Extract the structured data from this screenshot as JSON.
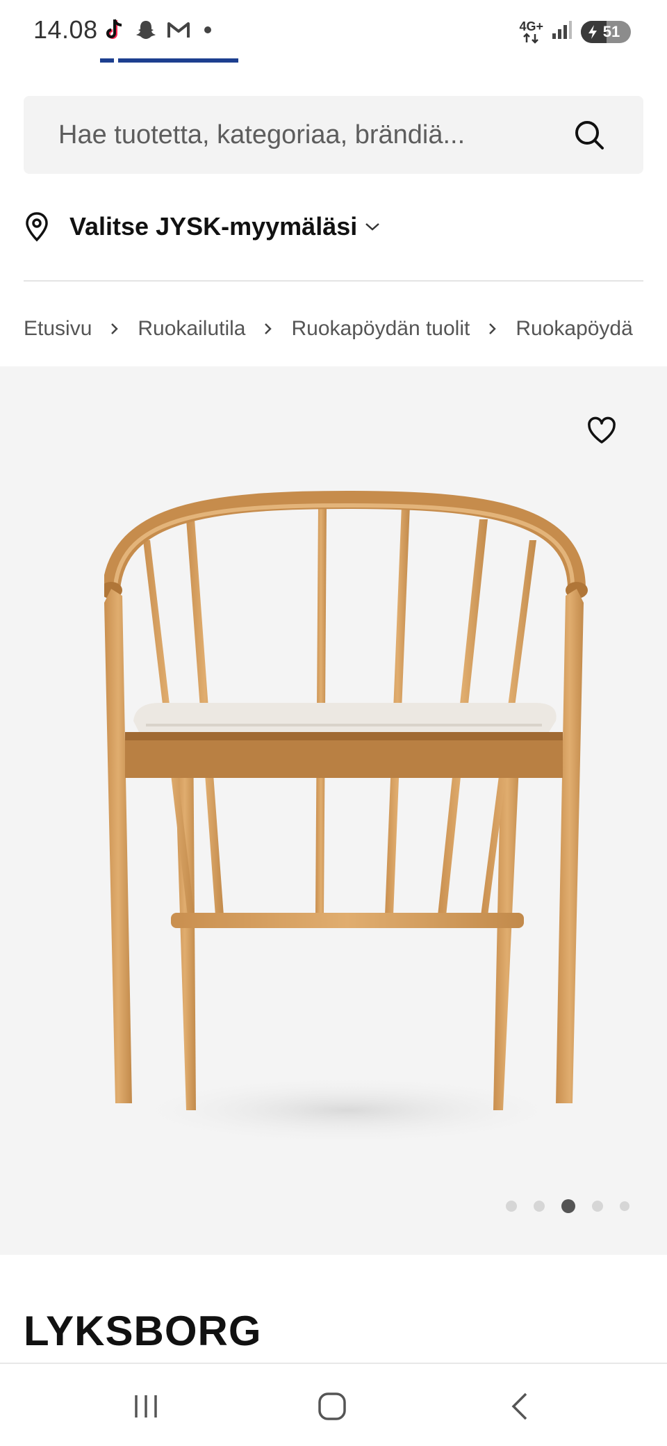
{
  "status_bar": {
    "time": "14.08",
    "network": "4G+",
    "battery": "51",
    "battery_level": 0.51,
    "notification_icons": [
      "tiktok-icon",
      "snapchat-icon",
      "gmail-icon"
    ]
  },
  "search": {
    "placeholder": "Hae tuotetta, kategoriaa, brändiä..."
  },
  "store": {
    "label": "Valitse JYSK-myymäläsi"
  },
  "breadcrumb": [
    "Etusivu",
    "Ruokailutila",
    "Ruokapöydän tuolit",
    "Ruokapöydä"
  ],
  "gallery": {
    "dot_count": 5,
    "active_index": 2
  },
  "product": {
    "title": "LYKSBORG"
  },
  "colors": {
    "accent": "#1d3f8f",
    "search_bg": "#f3f3f3",
    "hero_bg": "#f4f4f4"
  }
}
